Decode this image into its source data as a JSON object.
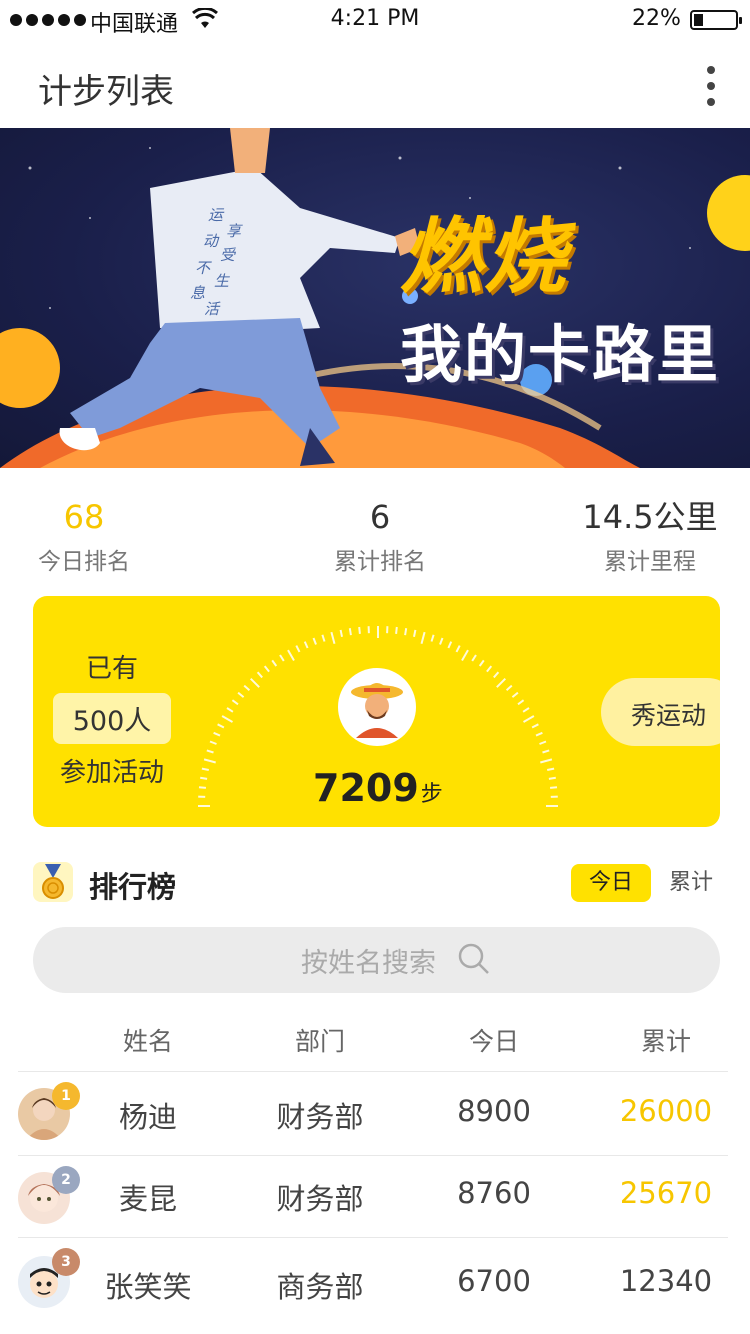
{
  "status_bar": {
    "carrier": "中国联通",
    "time": "4:21 PM",
    "battery": "22%",
    "battery_level": 0.22
  },
  "nav": {
    "title": "计步列表",
    "more_icon": "more-vertical-icon"
  },
  "banner": {
    "headline": "燃烧",
    "subheadline": "我的卡路里",
    "shirt_text": [
      "运",
      "享",
      "动",
      "受",
      "不",
      "生",
      "息",
      "活"
    ]
  },
  "stats": [
    {
      "value": "68",
      "label": "今日排名"
    },
    {
      "value": "6",
      "label": "累计排名"
    },
    {
      "value": "14.5公里",
      "label": "累计里程"
    }
  ],
  "card": {
    "joined_prefix": "已有",
    "joined_count": "500人",
    "joined_suffix": "参加活动",
    "steps": "7209",
    "steps_unit": "步",
    "share_label": "秀运动"
  },
  "leaderboard": {
    "title": "排行榜",
    "tabs": [
      "今日",
      "累计"
    ],
    "active_tab": "今日",
    "search_placeholder": "按姓名搜索",
    "columns": [
      "姓名",
      "部门",
      "今日",
      "累计"
    ],
    "rows": [
      {
        "rank": "1",
        "name": "杨迪",
        "dept": "财务部",
        "today": "8900",
        "total": "26000",
        "highlight": true
      },
      {
        "rank": "2",
        "name": "麦昆",
        "dept": "财务部",
        "today": "8760",
        "total": "25670",
        "highlight": true
      },
      {
        "rank": "3",
        "name": "张笑笑",
        "dept": "商务部",
        "today": "6700",
        "total": "12340",
        "highlight": false
      }
    ]
  },
  "colors": {
    "accent": "#ffe100",
    "highlight_text": "#f7c600",
    "banner_bg": "#1a1f4a"
  }
}
